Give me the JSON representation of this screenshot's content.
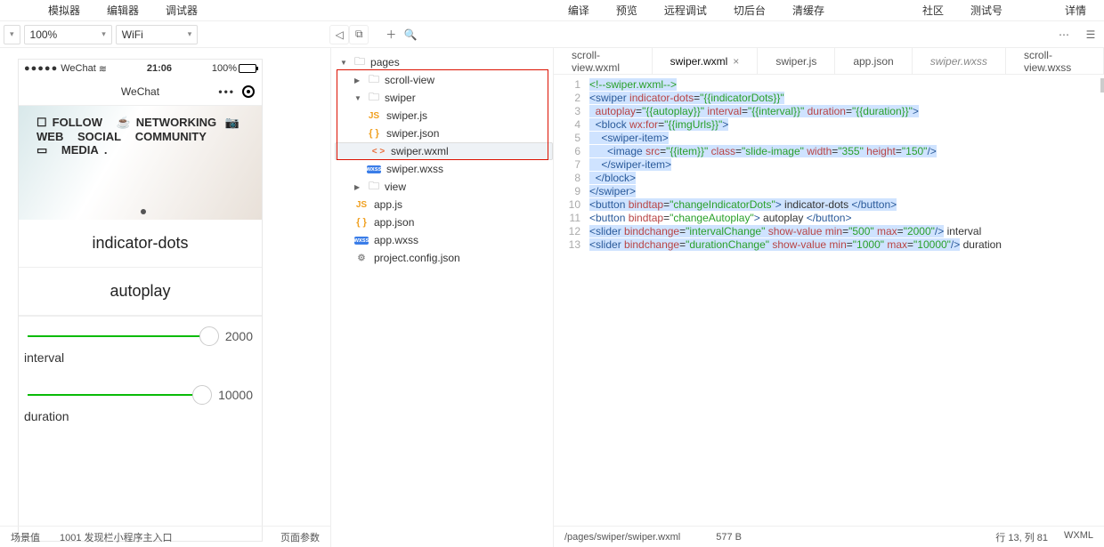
{
  "menu": {
    "left": [
      "模拟器",
      "编辑器",
      "调试器"
    ],
    "right": [
      "编译",
      "预览",
      "远程调试",
      "切后台",
      "清缓存",
      "社区",
      "测试号",
      "详情"
    ]
  },
  "toolbar": {
    "zoom": "100%",
    "network": "WiFi"
  },
  "simulator": {
    "carrier": "WeChat",
    "time": "21:06",
    "battery": "100%",
    "title": "WeChat",
    "hero_words": [
      "FOLLOW",
      "NETWORKING",
      "WEB",
      "SOCIAL",
      "COMMUNITY",
      "MEDIA"
    ],
    "btn1": "indicator-dots",
    "btn2": "autoplay",
    "val1": "2000",
    "label1": "interval",
    "val2": "10000",
    "label2": "duration",
    "bottom_left": "场景值",
    "bottom_mid": "1001 发现栏小程序主入口",
    "bottom_right": "页面参数"
  },
  "tree": {
    "root": "pages",
    "n1": "scroll-view",
    "n2": "swiper",
    "f1": "swiper.js",
    "f2": "swiper.json",
    "f3": "swiper.wxml",
    "f4": "swiper.wxss",
    "n3": "view",
    "r1": "app.js",
    "r2": "app.json",
    "r3": "app.wxss",
    "r4": "project.config.json"
  },
  "tabs": [
    "scroll-view.wxml",
    "swiper.wxml",
    "swiper.js",
    "app.json",
    "swiper.wxss",
    "scroll-view.wxss"
  ],
  "active_tab": 1,
  "code_lines": 13,
  "footer": {
    "path": "/pages/swiper/swiper.wxml",
    "size": "577 B",
    "pos": "行 13, 列 81",
    "lang": "WXML"
  }
}
